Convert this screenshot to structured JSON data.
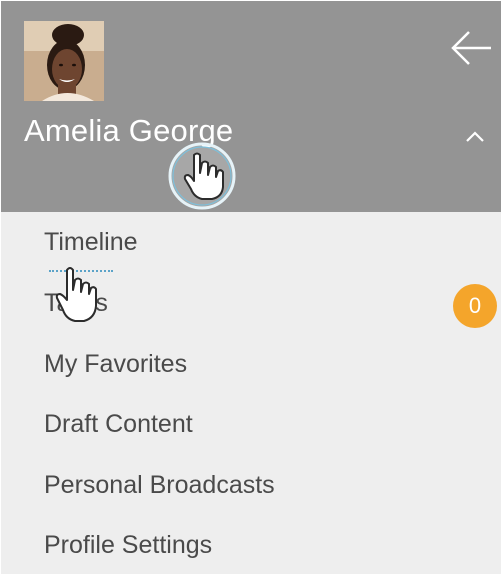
{
  "profile": {
    "name": "Amelia George"
  },
  "icons": {
    "back": "arrow-left-icon",
    "collapse": "chevron-up-icon",
    "cursor": "hand-pointer-icon"
  },
  "menu": {
    "items": [
      {
        "label": "Timeline"
      },
      {
        "label": "Tasks",
        "badge": "0"
      },
      {
        "label": "My Favorites"
      },
      {
        "label": "Draft Content"
      },
      {
        "label": "Personal Broadcasts"
      },
      {
        "label": "Profile Settings"
      }
    ]
  },
  "colors": {
    "header_bg": "#949494",
    "menu_bg": "#eeeeee",
    "badge": "#f4a52b",
    "text": "#4a4a4a",
    "highlight": "#5ba3c8"
  }
}
